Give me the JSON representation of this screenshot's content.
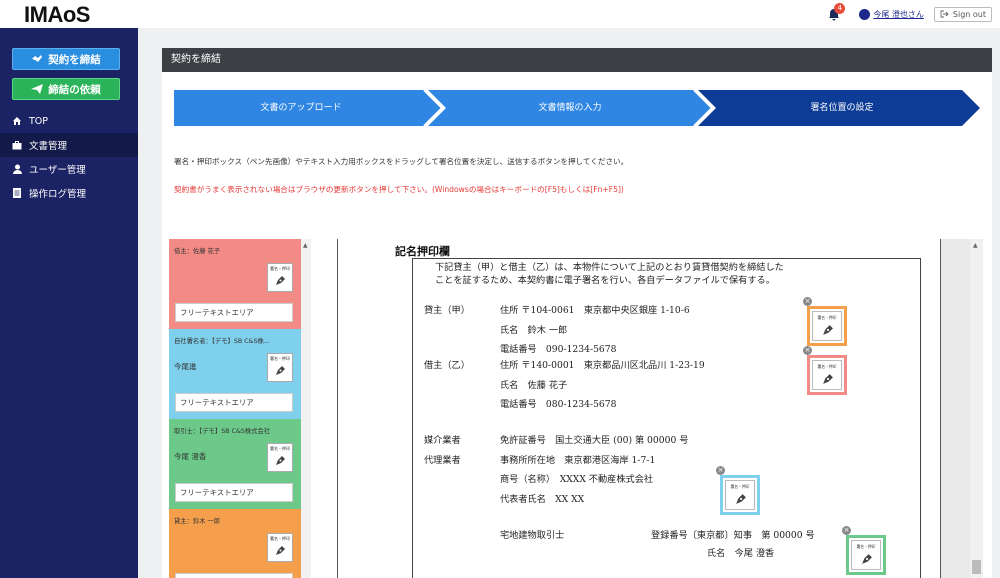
{
  "header": {
    "logo": "IMAoS",
    "notification_count": "4",
    "user_name": "今尾 澄也さん",
    "signout_label": "Sign out"
  },
  "sidebar": {
    "btn_contract": "契約を締結",
    "btn_request": "締結の依頼",
    "items": [
      {
        "label": "TOP",
        "icon": "home-icon"
      },
      {
        "label": "文書管理",
        "icon": "briefcase-icon",
        "active": true
      },
      {
        "label": "ユーザー管理",
        "icon": "user-icon"
      },
      {
        "label": "操作ログ管理",
        "icon": "document-icon"
      }
    ]
  },
  "panel": {
    "title": "契約を締結",
    "steps": [
      "文書のアップロード",
      "文書情報の入力",
      "署名位置の設定"
    ],
    "instruction": "署名・押印ボックス（ペン先画像）やテキスト入力用ボックスをドラッグして署名位置を決定し、送信するボタンを押してください。",
    "warning": "契約書がうまく表示されない場合はブラウザの更新ボタンを押して下さい。(Windowsの場合はキーボードの[F5]もしくは[Fn+F5])"
  },
  "boxes": [
    {
      "title": "借主：佐藤 花子",
      "name": "",
      "free": "フリーテキストエリア",
      "color": "#f28b86"
    },
    {
      "title": "自社署名者：【デモ】SB C&S株...",
      "name": "今尾進",
      "free": "フリーテキストエリア",
      "color": "#7fd0ec"
    },
    {
      "title": "取引士：【デモ】SB C&S株式会社",
      "name": "今尾 澄香",
      "free": "フリーテキストエリア",
      "color": "#6cc98a"
    },
    {
      "title": "貸主：鈴木 一郎",
      "name": "",
      "free": "",
      "color": "#f59f4c"
    }
  ],
  "stamp_label": "署名・押印",
  "document": {
    "title": "記名押印欄",
    "intro1": "下記貸主（甲）と借主（乙）は、本物件について上記のとおり賃貸借契約を締結した",
    "intro2": "ことを証するため、本契約書に電子署名を行い、各自データファイルで保有する。",
    "lessor_label": "貸主（甲）",
    "lessor_addr": "住所 〒104-0061　東京都中央区銀座 1-10-6",
    "lessor_name": "氏名　鈴木 一郎",
    "lessor_tel": "電話番号　090-1234-5678",
    "lessee_label": "借主（乙）",
    "lessee_addr": "住所 〒140-0001　東京都品川区北品川 1-23-19",
    "lessee_name": "氏名　佐藤 花子",
    "lessee_tel": "電話番号　080-1234-5678",
    "broker_label": "媒介業者",
    "broker_license": "免許証番号　国土交通大臣 (00) 第 00000 号",
    "agent_label": "代理業者",
    "agent_office": "事務所所在地　東京都港区海岸 1-7-1",
    "agent_trade": "商号（名称）　XXXX 不動産株式会社",
    "agent_rep": "代表者氏名　XX XX",
    "agent_rep_label": "",
    "realtor_label": "宅地建物取引士",
    "realtor_reg": "登録番号〔東京都〕知事　第 00000 号",
    "realtor_name": "氏名　今尾 澄香"
  },
  "colors": {
    "orange": "#f59f4c",
    "red": "#f28b86",
    "blue": "#7fd0ec",
    "green": "#6cc98a",
    "step_light": "#2f86e3",
    "step_dark": "#0d3c96"
  }
}
